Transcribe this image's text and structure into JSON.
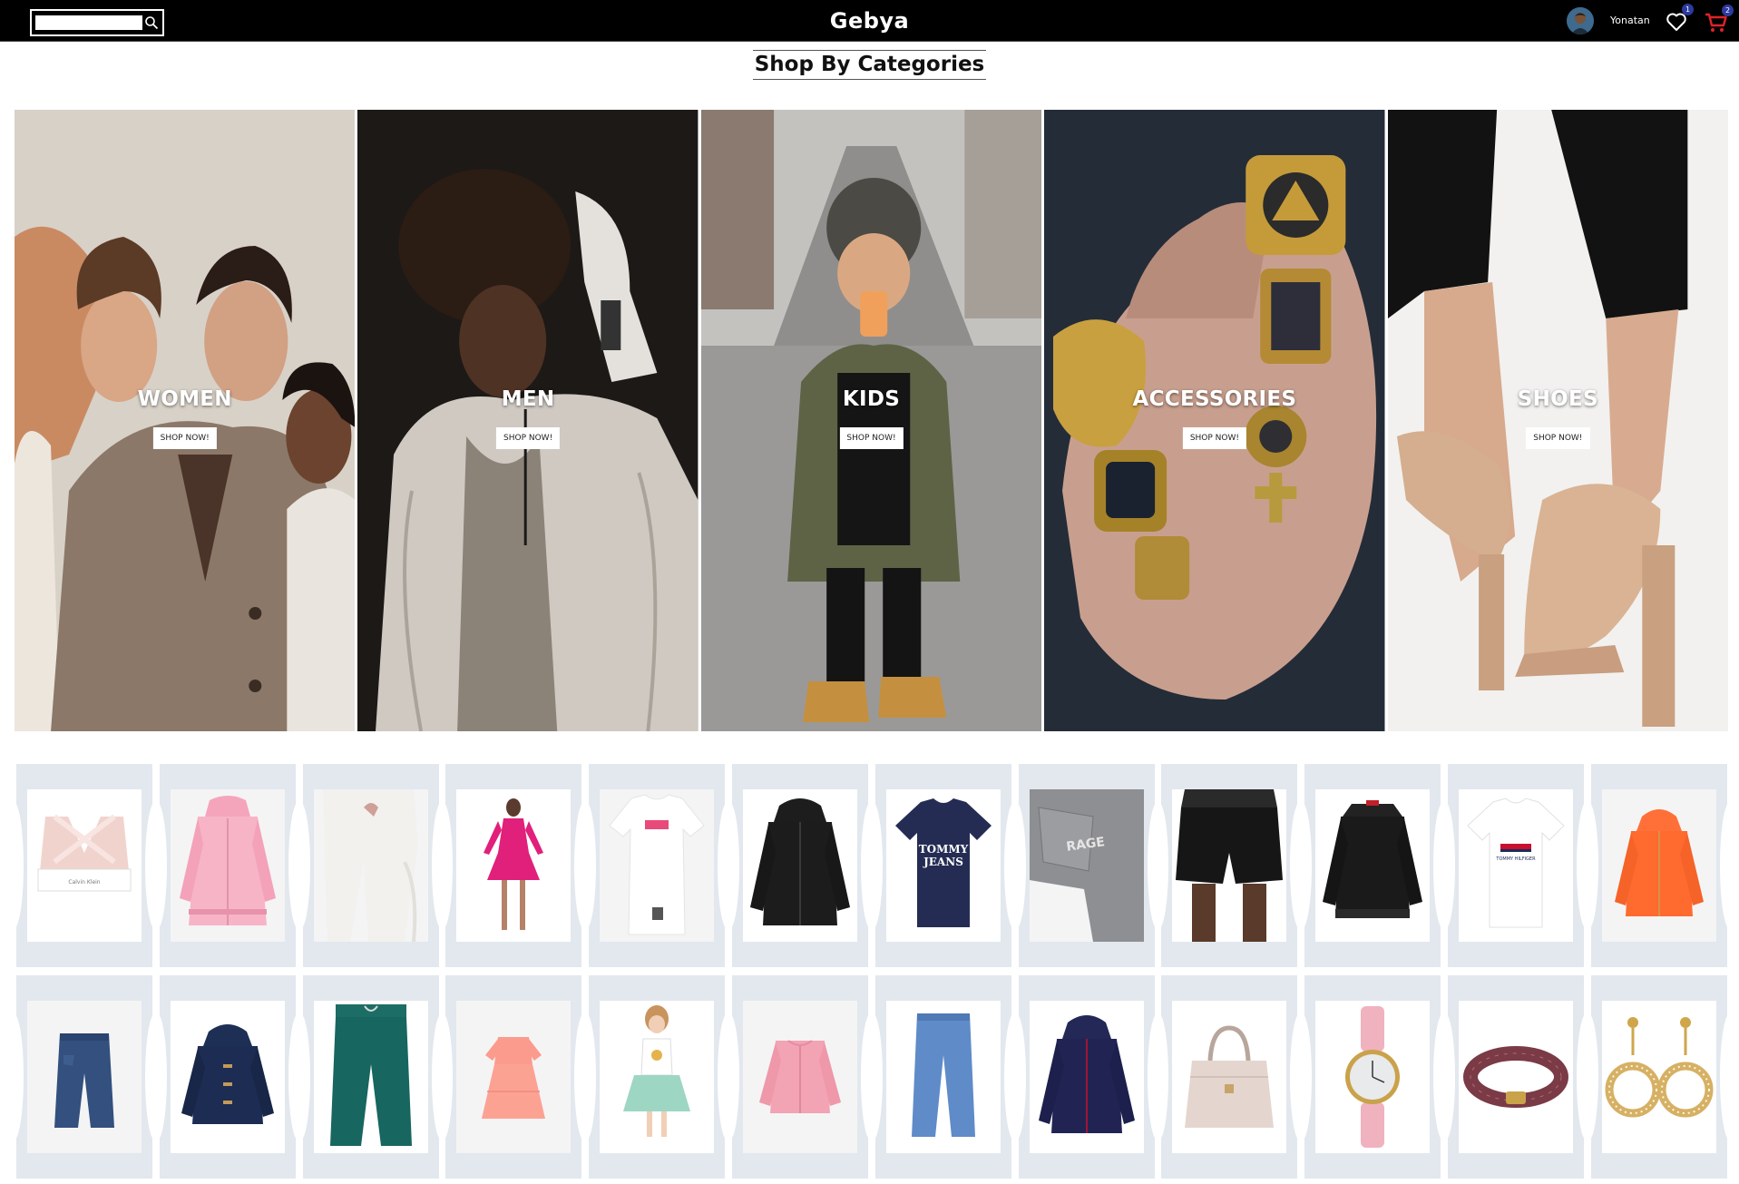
{
  "header": {
    "brand": "Gebya",
    "search": {
      "placeholder": "",
      "value": ""
    },
    "user": {
      "name": "Yonatan"
    },
    "wishlist_count": "1",
    "cart_count": "2",
    "colors": {
      "bar": "#000000",
      "badge": "#2d3a9e",
      "cart": "#e0222a"
    }
  },
  "section": {
    "title": "Shop By Categories"
  },
  "categories": [
    {
      "label": "WOMEN",
      "button": "SHOP NOW!"
    },
    {
      "label": "MEN",
      "button": "SHOP NOW!"
    },
    {
      "label": "KIDS",
      "button": "SHOP NOW!"
    },
    {
      "label": "ACCESSORIES",
      "button": "SHOP NOW!"
    },
    {
      "label": "SHOES",
      "button": "SHOP NOW!"
    }
  ],
  "products": [
    {
      "item": "pink-sports-bra"
    },
    {
      "item": "pink-hooded-jacket"
    },
    {
      "item": "white-jeans"
    },
    {
      "item": "pink-wrap-dress"
    },
    {
      "item": "white-t-shirt-dress"
    },
    {
      "item": "black-zip-hoodie"
    },
    {
      "item": "navy-tommy-jeans-tshirt"
    },
    {
      "item": "grey-denim-jeans"
    },
    {
      "item": "black-shorts"
    },
    {
      "item": "black-bomber-jacket"
    },
    {
      "item": "white-tommy-tshirt"
    },
    {
      "item": "orange-kids-hoodie"
    },
    {
      "item": "kids-blue-jeans"
    },
    {
      "item": "navy-kids-duffle-coat"
    },
    {
      "item": "teal-joggers"
    },
    {
      "item": "peach-ruffle-dress"
    },
    {
      "item": "girl-tutu-outfit"
    },
    {
      "item": "pink-kids-jacket"
    },
    {
      "item": "light-blue-kids-jeans"
    },
    {
      "item": "navy-kids-zip-hoodie"
    },
    {
      "item": "beige-handbag"
    },
    {
      "item": "pink-strap-watch"
    },
    {
      "item": "brown-logo-belt"
    },
    {
      "item": "gold-drop-earrings"
    }
  ]
}
